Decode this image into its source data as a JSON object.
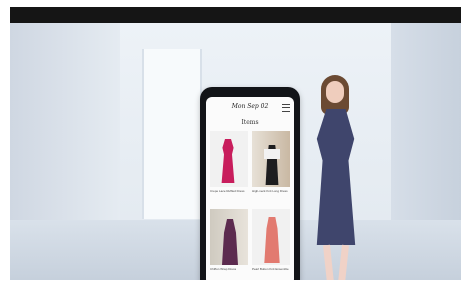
{
  "phone": {
    "brand": "Mon Sep 02",
    "section_title": "Items",
    "products": [
      {
        "caption": "Crepe Lace Ruffled Dress"
      },
      {
        "caption": "High-neck Knit Long Dress"
      },
      {
        "caption": "Chiffon Wrap Dress"
      },
      {
        "caption": "Pearl Button Knit Ensemble"
      }
    ]
  },
  "colors": {
    "top_bar": "#151515",
    "room_wall": "#e7edf3",
    "phone_frame": "#121418",
    "accent_dress": "#c81d5c",
    "model_dress": "#3f456c",
    "shoes": "#d1165f"
  }
}
